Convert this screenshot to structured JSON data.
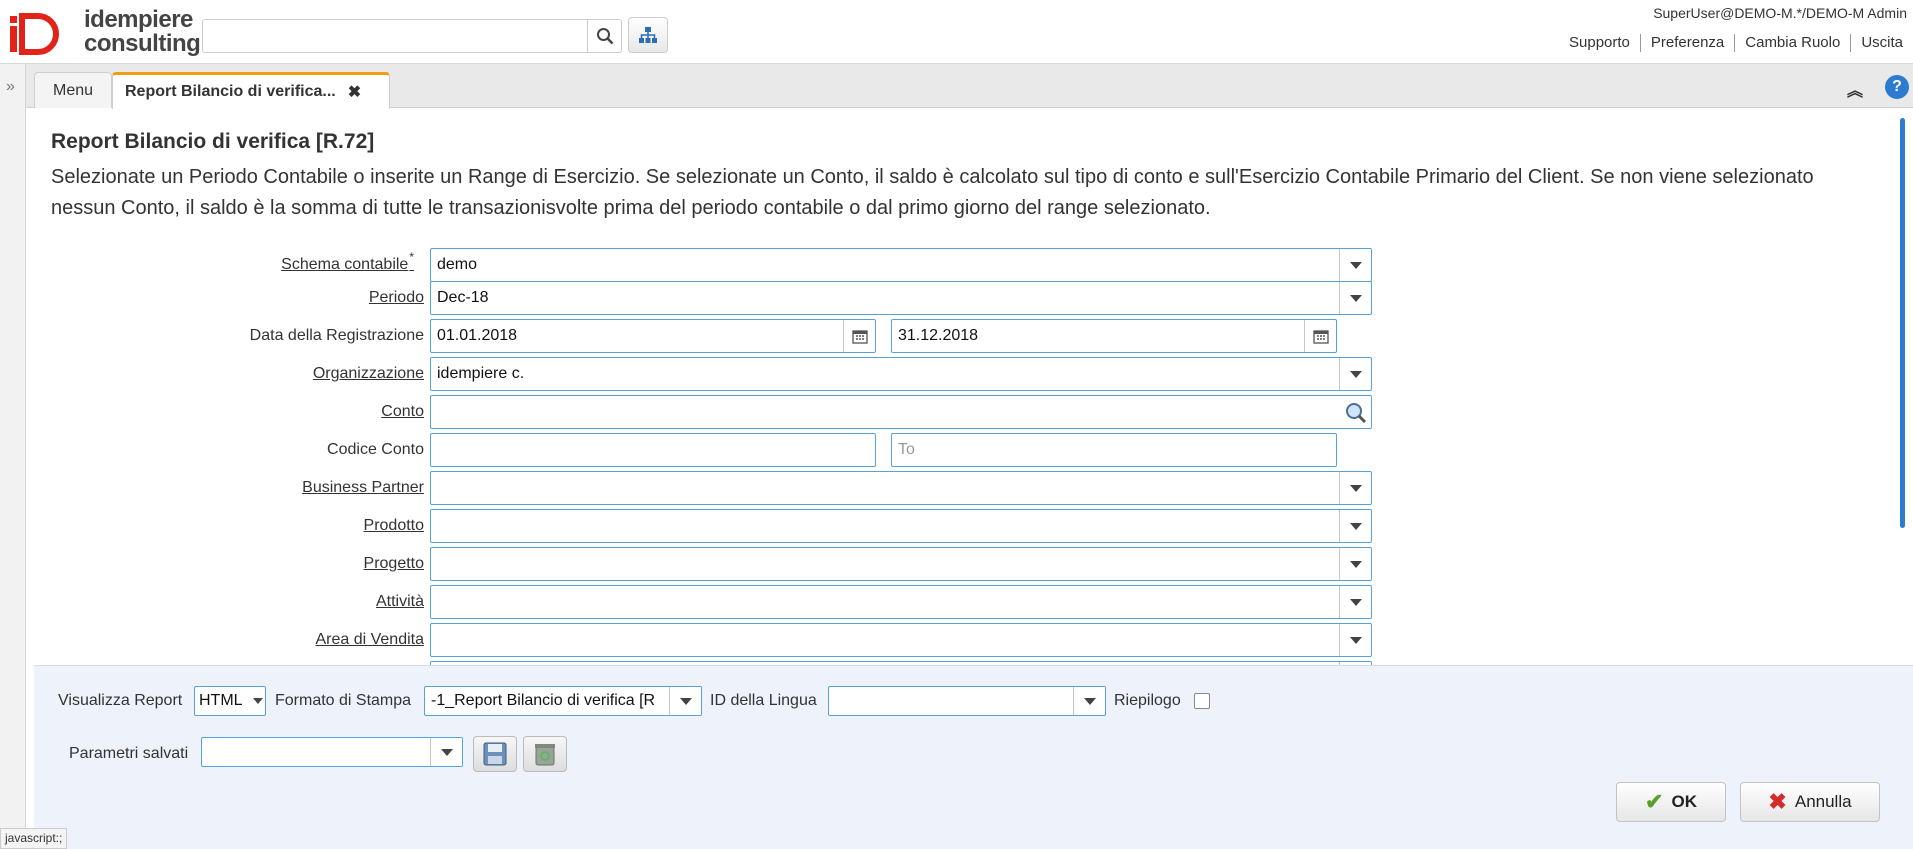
{
  "header": {
    "logo_line1": "idempiere",
    "logo_line2": "consulting",
    "search_value": "",
    "user": "SuperUser@DEMO-M.*/DEMO-M Admin",
    "links": [
      "Supporto",
      "Preferenza",
      "Cambia Ruolo",
      "Uscita"
    ]
  },
  "tabs": {
    "menu": "Menu",
    "active": "Report Bilancio di verifica...",
    "close_glyph": "✖"
  },
  "form": {
    "title": "Report Bilancio di verifica [R.72]",
    "description": "Selezionate un Periodo Contabile o inserite un Range di Esercizio. Se selezionate un Conto, il saldo è calcolato sul tipo di conto e sull'Esercizio Contabile Primario del Client. Se non viene selezionato nessun Conto, il saldo è la somma di tutte le transazionisvolte prima del periodo contabile o dal primo giorno del range selezionato.",
    "fields": {
      "schema_label": "Schema contabile",
      "schema_required": "*",
      "schema_value": "demo",
      "periodo_label": "Periodo",
      "periodo_value": "Dec-18",
      "data_label": "Data della Registrazione",
      "data_from": "01.01.2018",
      "data_to": "31.12.2018",
      "org_label": "Organizzazione",
      "org_value": "idempiere c.",
      "conto_label": "Conto",
      "conto_value": "",
      "codice_label": "Codice Conto",
      "codice_from": "",
      "codice_to_placeholder": "To",
      "bp_label": "Business Partner",
      "prodotto_label": "Prodotto",
      "progetto_label": "Progetto",
      "attivita_label": "Attività",
      "area_label": "Area di Vendita"
    }
  },
  "footer": {
    "visualizza_label": "Visualizza Report",
    "visualizza_value": "HTML",
    "formato_label": "Formato di Stampa",
    "formato_value": "-1_Report Bilancio di verifica [R",
    "lingua_label": "ID della Lingua",
    "lingua_value": "",
    "riepilogo_label": "Riepilogo",
    "parametri_label": "Parametri salvati",
    "parametri_value": "",
    "ok_label": "OK",
    "annulla_label": "Annulla"
  },
  "status_bar": "javascript:;",
  "colors": {
    "accent": "#2c7bd1",
    "tab_highlight": "#f39c12",
    "field_border": "#57a3d9",
    "ok_check": "#5aa02c",
    "cancel_x": "#d62b2b",
    "logo_red": "#e2231a"
  }
}
